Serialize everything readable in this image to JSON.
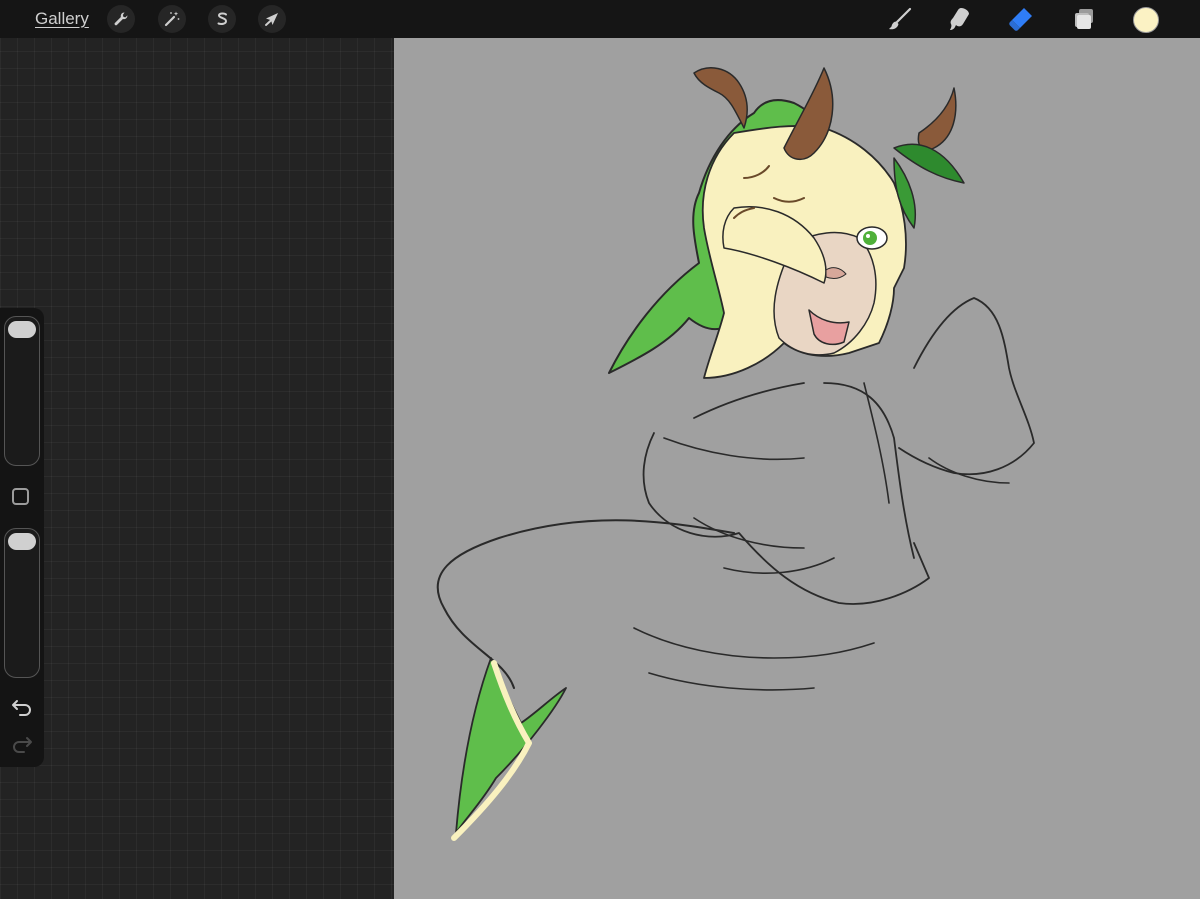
{
  "app": {
    "gallery_label": "Gallery"
  },
  "toolbar": {
    "left_tools": [
      {
        "name": "actions",
        "icon": "wrench-icon"
      },
      {
        "name": "adjustments",
        "icon": "magic-wand-icon"
      },
      {
        "name": "selection",
        "icon": "selection-s-icon"
      },
      {
        "name": "transform",
        "icon": "arrow-cursor-icon"
      }
    ],
    "right_tools": [
      {
        "name": "brush",
        "icon": "brush-icon",
        "active": false
      },
      {
        "name": "smudge",
        "icon": "smudge-icon",
        "active": false
      },
      {
        "name": "eraser",
        "icon": "eraser-icon",
        "active": true
      },
      {
        "name": "layers",
        "icon": "layers-icon",
        "active": false
      }
    ],
    "current_color": "#fbf2c4"
  },
  "sidebar": {
    "brush_size": 1.0,
    "opacity": 1.0,
    "undo_icon": "undo-icon",
    "redo_icon": "redo-icon",
    "redo_enabled": false
  },
  "colors": {
    "accent_active": "#2f7df6",
    "canvas_background": "#a0a0a0",
    "hair_fill": "#f9f1bf",
    "hair_green": "#5fbe4b",
    "horn": "#8a5a3a",
    "skin": "#e9d6c4",
    "line": "#2a2a2a"
  }
}
